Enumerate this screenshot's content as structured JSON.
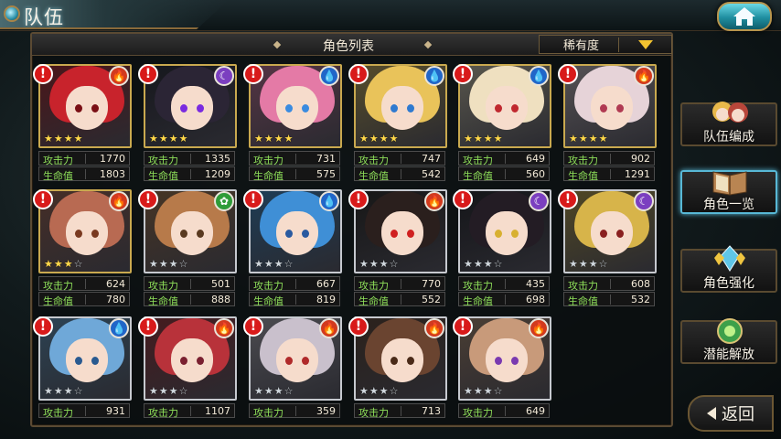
{
  "header": {
    "title": "队伍"
  },
  "list": {
    "title": "角色列表",
    "sort_label": "稀有度"
  },
  "stat_labels": {
    "atk": "攻击力",
    "hp": "生命值"
  },
  "menu": [
    {
      "label": "队伍编成",
      "icon": "team-portraits-icon"
    },
    {
      "label": "角色一览",
      "icon": "book-icon",
      "active": true
    },
    {
      "label": "角色强化",
      "icon": "crystal-icon"
    },
    {
      "label": "潜能解放",
      "icon": "potential-orb-icon"
    }
  ],
  "back_label": "返回",
  "colors": {
    "gold_frame": "#c9a94f",
    "silver_frame": "#c6c9cf",
    "stat_label": "#8fe05a",
    "alert": "#d81a1a"
  },
  "characters": [
    {
      "element": "fire",
      "stars": 4,
      "rarity": "gold",
      "atk": "1770",
      "hp": "1803",
      "hair": "#c8232c",
      "eyes": "#7a0f15"
    },
    {
      "element": "dark",
      "stars": 4,
      "rarity": "gold",
      "atk": "1335",
      "hp": "1209",
      "hair": "#2b2535",
      "eyes": "#7a2be0"
    },
    {
      "element": "water",
      "stars": 4,
      "rarity": "gold",
      "atk": "731",
      "hp": "575",
      "hair": "#e47aa6",
      "eyes": "#3a8be0"
    },
    {
      "element": "water",
      "stars": 4,
      "rarity": "gold",
      "atk": "747",
      "hp": "542",
      "hair": "#e9c35a",
      "eyes": "#2f7ad0"
    },
    {
      "element": "water",
      "stars": 4,
      "rarity": "gold",
      "atk": "649",
      "hp": "560",
      "hair": "#efe0c0",
      "eyes": "#c0282f"
    },
    {
      "element": "fire",
      "stars": 4,
      "rarity": "gold",
      "atk": "902",
      "hp": "1291",
      "hair": "#e6d3d8",
      "eyes": "#b03a52"
    },
    {
      "element": "fire",
      "stars": 3,
      "rarity": "gold",
      "atk": "624",
      "hp": "780",
      "hair": "#b86a52",
      "eyes": "#7a3a20"
    },
    {
      "element": "wind",
      "stars": 3,
      "rarity": "silver",
      "atk": "501",
      "hp": "888",
      "hair": "#b77a4a",
      "eyes": "#5a3a20"
    },
    {
      "element": "water",
      "stars": 3,
      "rarity": "silver",
      "atk": "667",
      "hp": "819",
      "hair": "#3f8fd6",
      "eyes": "#2a5aa0"
    },
    {
      "element": "fire",
      "stars": 3,
      "rarity": "silver",
      "atk": "770",
      "hp": "552",
      "hair": "#2a1f1d",
      "eyes": "#d02020"
    },
    {
      "element": "dark",
      "stars": 3,
      "rarity": "silver",
      "atk": "435",
      "hp": "698",
      "hair": "#231c24",
      "eyes": "#d8b030"
    },
    {
      "element": "dark",
      "stars": 3,
      "rarity": "silver",
      "atk": "608",
      "hp": "532",
      "hair": "#d7b44a",
      "eyes": "#8a2020"
    },
    {
      "element": "water",
      "stars": 3,
      "rarity": "silver",
      "atk": "931",
      "hp": "",
      "hair": "#6fa8d8",
      "eyes": "#2a5a90"
    },
    {
      "element": "fire",
      "stars": 3,
      "rarity": "silver",
      "atk": "1107",
      "hp": "",
      "hair": "#b8323a",
      "eyes": "#7a2030"
    },
    {
      "element": "fire",
      "stars": 3,
      "rarity": "silver",
      "atk": "359",
      "hp": "",
      "hair": "#c9c0cc",
      "eyes": "#b02a2a"
    },
    {
      "element": "fire",
      "stars": 3,
      "rarity": "silver",
      "atk": "713",
      "hp": "",
      "hair": "#6a4430",
      "eyes": "#4a2a18"
    },
    {
      "element": "fire",
      "stars": 3,
      "rarity": "silver",
      "atk": "649",
      "hp": "",
      "hair": "#c89a7a",
      "eyes": "#7a3ab0"
    }
  ]
}
